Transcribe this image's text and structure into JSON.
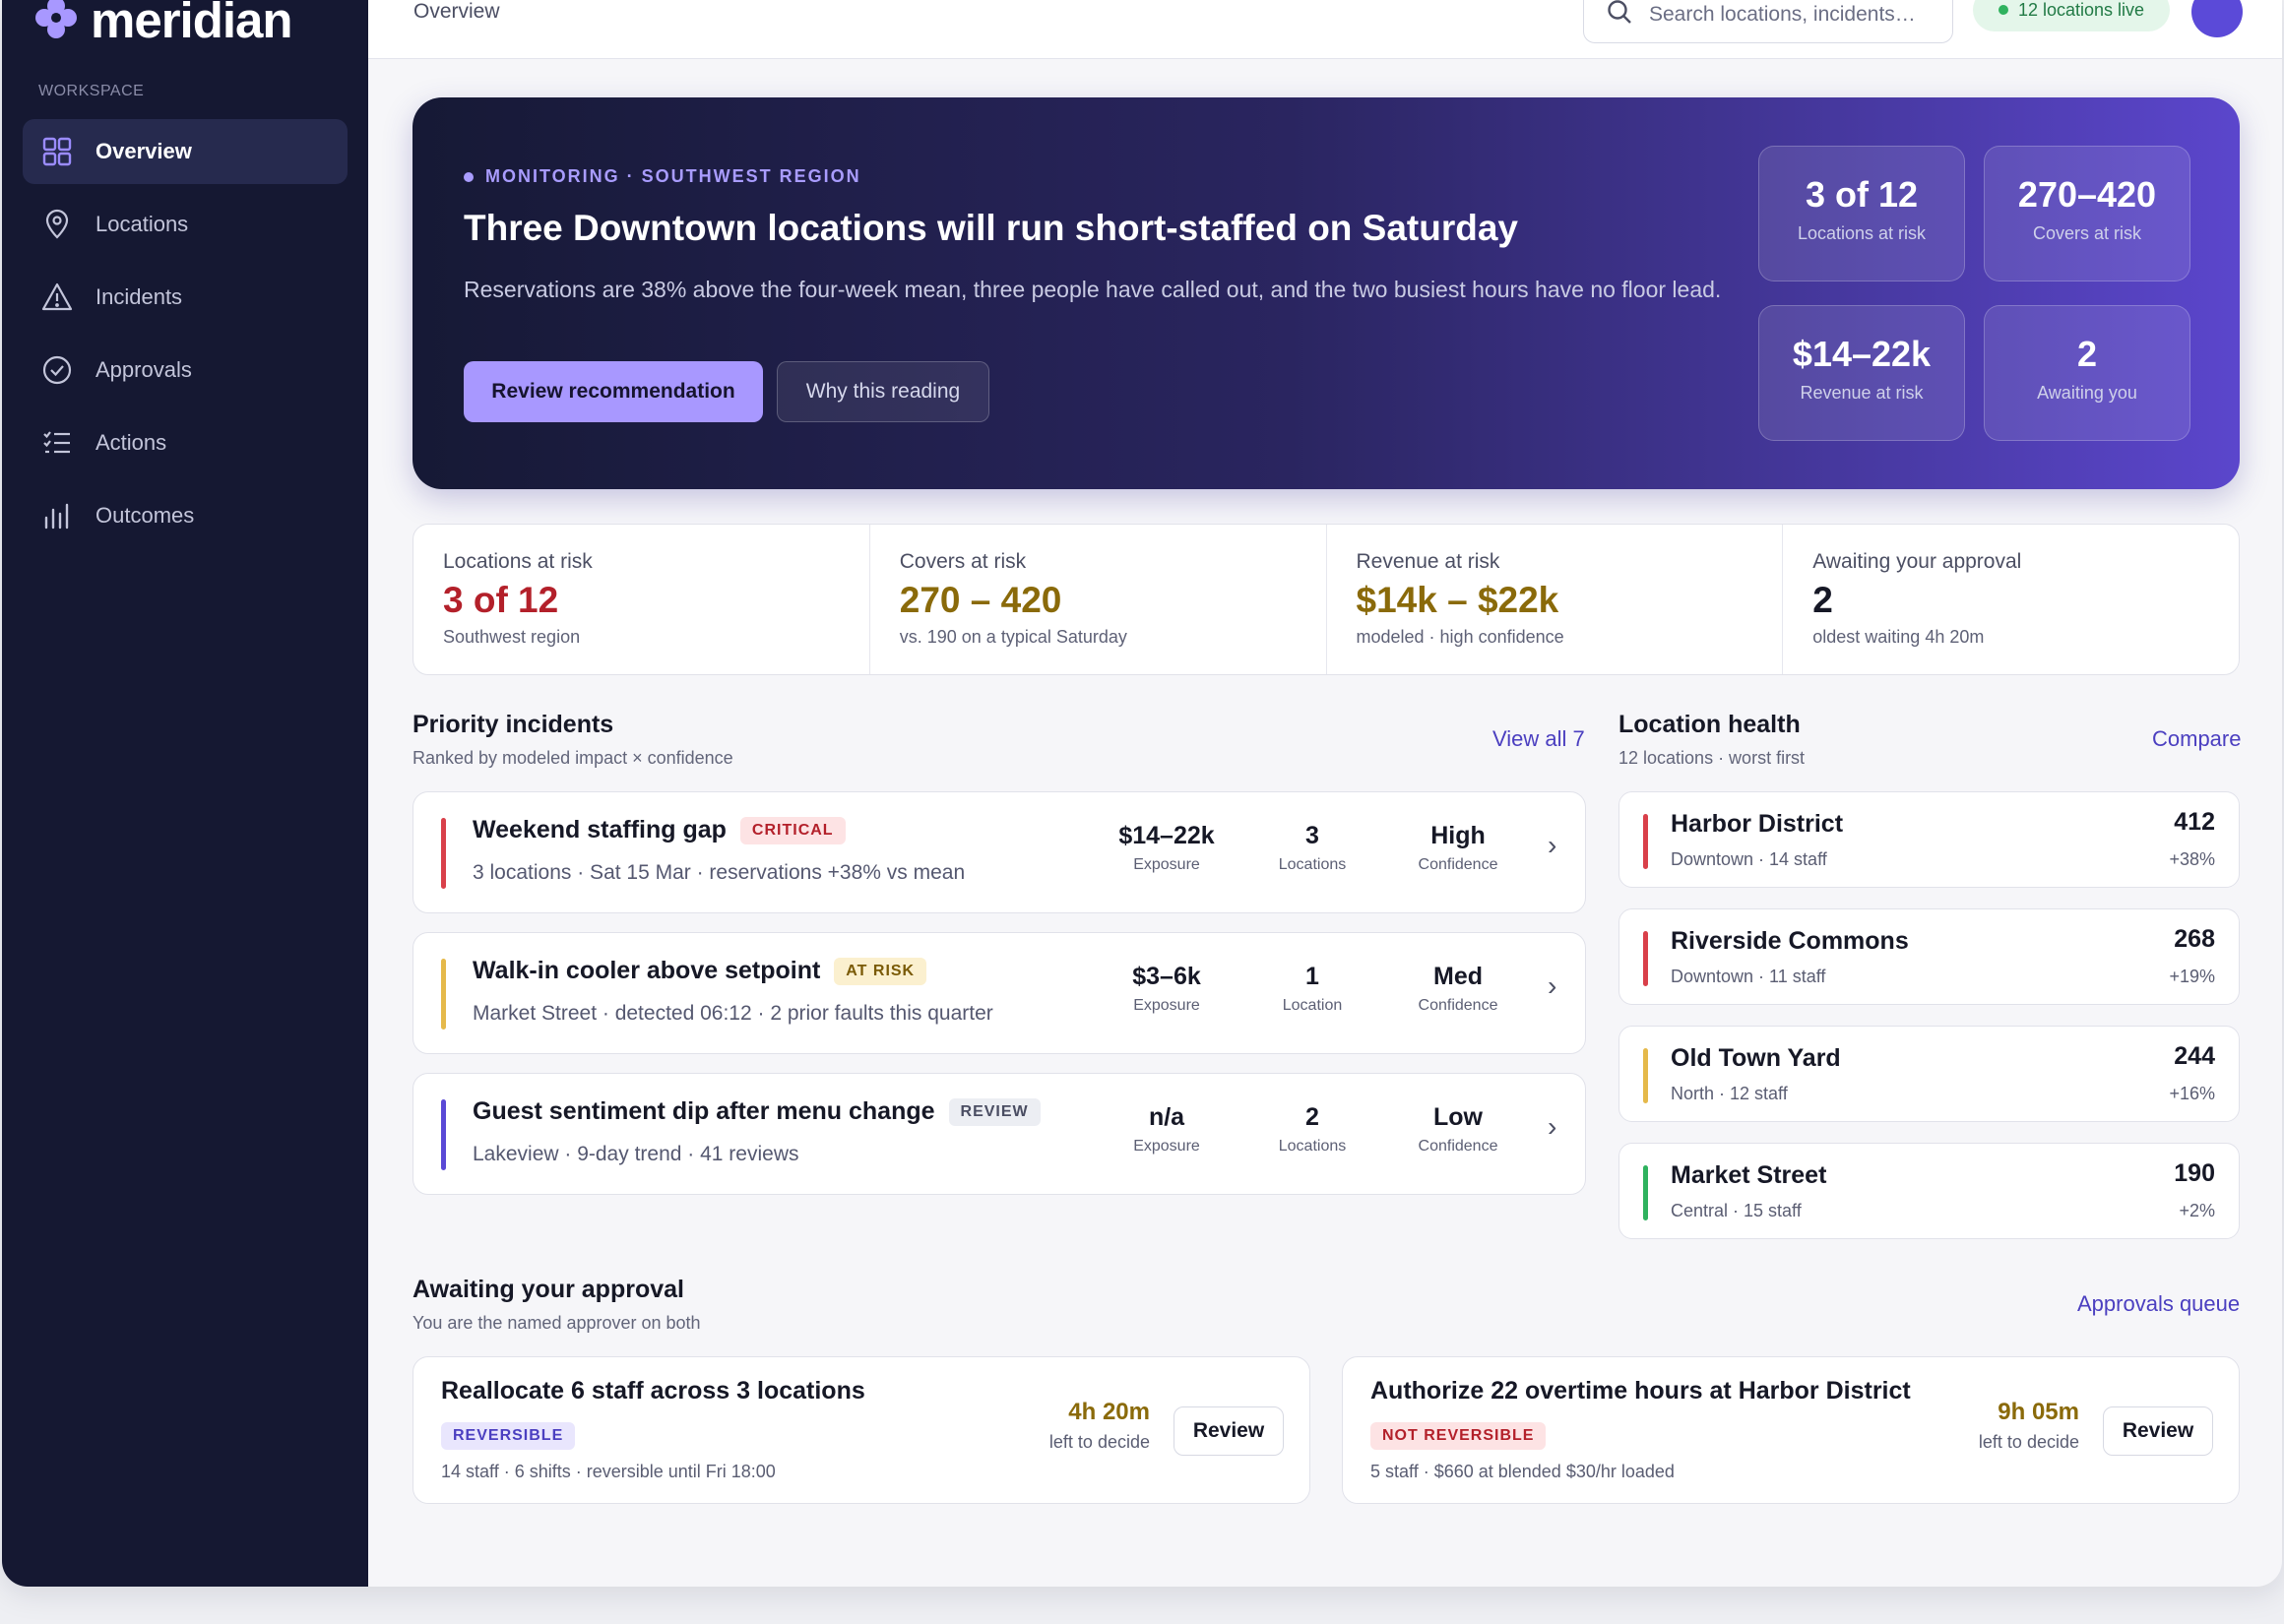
{
  "brand": {
    "name": "meridian"
  },
  "sidebar": {
    "section_label": "WORKSPACE",
    "items": [
      {
        "label": "Overview",
        "icon": "grid-icon",
        "active": true
      },
      {
        "label": "Locations",
        "icon": "map-pin-icon"
      },
      {
        "label": "Incidents",
        "icon": "warning-icon"
      },
      {
        "label": "Approvals",
        "icon": "check-circle-icon"
      },
      {
        "label": "Actions",
        "icon": "checklist-icon"
      },
      {
        "label": "Outcomes",
        "icon": "bar-chart-icon"
      }
    ]
  },
  "topbar": {
    "breadcrumb": "Overview",
    "search_placeholder": "Search locations, incidents…",
    "live_status": "12 locations live"
  },
  "hero": {
    "eyebrow": "MONITORING · SOUTHWEST REGION",
    "title": "Three Downtown locations will run short-staffed on Saturday",
    "description": "Reservations are 38% above the four-week mean, three people have called out, and the two busiest hours have no floor lead.",
    "primary_button": "Review recommendation",
    "secondary_button": "Why this reading",
    "stats": [
      {
        "value": "3 of 12",
        "label": "Locations at risk"
      },
      {
        "value": "270–420",
        "label": "Covers at risk"
      },
      {
        "value": "$14–22k",
        "label": "Revenue at risk"
      },
      {
        "value": "2",
        "label": "Awaiting you"
      }
    ]
  },
  "kpis": [
    {
      "title": "Locations at risk",
      "value": "3 of 12",
      "sub": "Southwest region",
      "color": "#b3202a"
    },
    {
      "title": "Covers at risk",
      "value": "270 – 420",
      "sub": "vs. 190 on a typical Saturday",
      "color": "#8a6a0a"
    },
    {
      "title": "Revenue at risk",
      "value": "$14k – $22k",
      "sub": "modeled · high confidence",
      "color": "#8a6a0a"
    },
    {
      "title": "Awaiting your approval",
      "value": "2",
      "sub": "oldest waiting 4h 20m",
      "color": "#161826"
    }
  ],
  "incidents": {
    "title": "Priority incidents",
    "subtitle": "Ranked by modeled impact × confidence",
    "link": "View all 7",
    "items": [
      {
        "name": "Weekend staffing gap",
        "badge": "CRITICAL",
        "meta": "3 locations · Sat 15 Mar · reservations +38% vs mean",
        "exposure": "$14–22k",
        "exposure_label": "Exposure",
        "count": "3",
        "count_label": "Locations",
        "confidence": "High",
        "confidence_label": "Confidence",
        "bar_color": "#d9404a",
        "badge_bg": "#fde3e4",
        "badge_fg": "#b3202a"
      },
      {
        "name": "Walk-in cooler above setpoint",
        "badge": "AT RISK",
        "meta": "Market Street · detected 06:12 · 2 prior faults this quarter",
        "exposure": "$3–6k",
        "exposure_label": "Exposure",
        "count": "1",
        "count_label": "Location",
        "confidence": "Med",
        "confidence_label": "Confidence",
        "bar_color": "#e5b94a",
        "badge_bg": "#fbf0cf",
        "badge_fg": "#7a5a06"
      },
      {
        "name": "Guest sentiment dip after menu change",
        "badge": "REVIEW",
        "meta": "Lakeview · 9-day trend · 41 reviews",
        "exposure": "n/a",
        "exposure_label": "Exposure",
        "count": "2",
        "count_label": "Locations",
        "confidence": "Low",
        "confidence_label": "Confidence",
        "bar_color": "#5a49d6",
        "badge_bg": "#eceef3",
        "badge_fg": "#4a4d62"
      }
    ]
  },
  "locations": {
    "title": "Location health",
    "subtitle": "12 locations · worst first",
    "link": "Compare",
    "items": [
      {
        "name": "Harbor District",
        "meta": "Downtown · 14 staff",
        "value": "412",
        "delta": "+38%",
        "bar_color": "#d9404a"
      },
      {
        "name": "Riverside Commons",
        "meta": "Downtown · 11 staff",
        "value": "268",
        "delta": "+19%",
        "bar_color": "#d9404a"
      },
      {
        "name": "Old Town Yard",
        "meta": "North · 12 staff",
        "value": "244",
        "delta": "+16%",
        "bar_color": "#e5b94a"
      },
      {
        "name": "Market Street",
        "meta": "Central · 15 staff",
        "value": "190",
        "delta": "+2%",
        "bar_color": "#2fb25e"
      }
    ]
  },
  "approvals": {
    "title": "Awaiting your approval",
    "subtitle": "You are the named approver on both",
    "link": "Approvals queue",
    "items": [
      {
        "name": "Reallocate 6 staff across 3 locations",
        "badge": "REVERSIBLE",
        "meta": "14 staff · 6 shifts · reversible until Fri 18:00",
        "time": "4h 20m",
        "time_label": "left to decide",
        "button": "Review",
        "badge_bg": "#e9e6fd",
        "badge_fg": "#4b3fc0"
      },
      {
        "name": "Authorize 22 overtime hours at Harbor District",
        "badge": "NOT REVERSIBLE",
        "meta": "5 staff · $660 at blended $30/hr loaded",
        "time": "9h 05m",
        "time_label": "left to decide",
        "button": "Review",
        "badge_bg": "#fde3e4",
        "badge_fg": "#b3202a"
      }
    ]
  }
}
